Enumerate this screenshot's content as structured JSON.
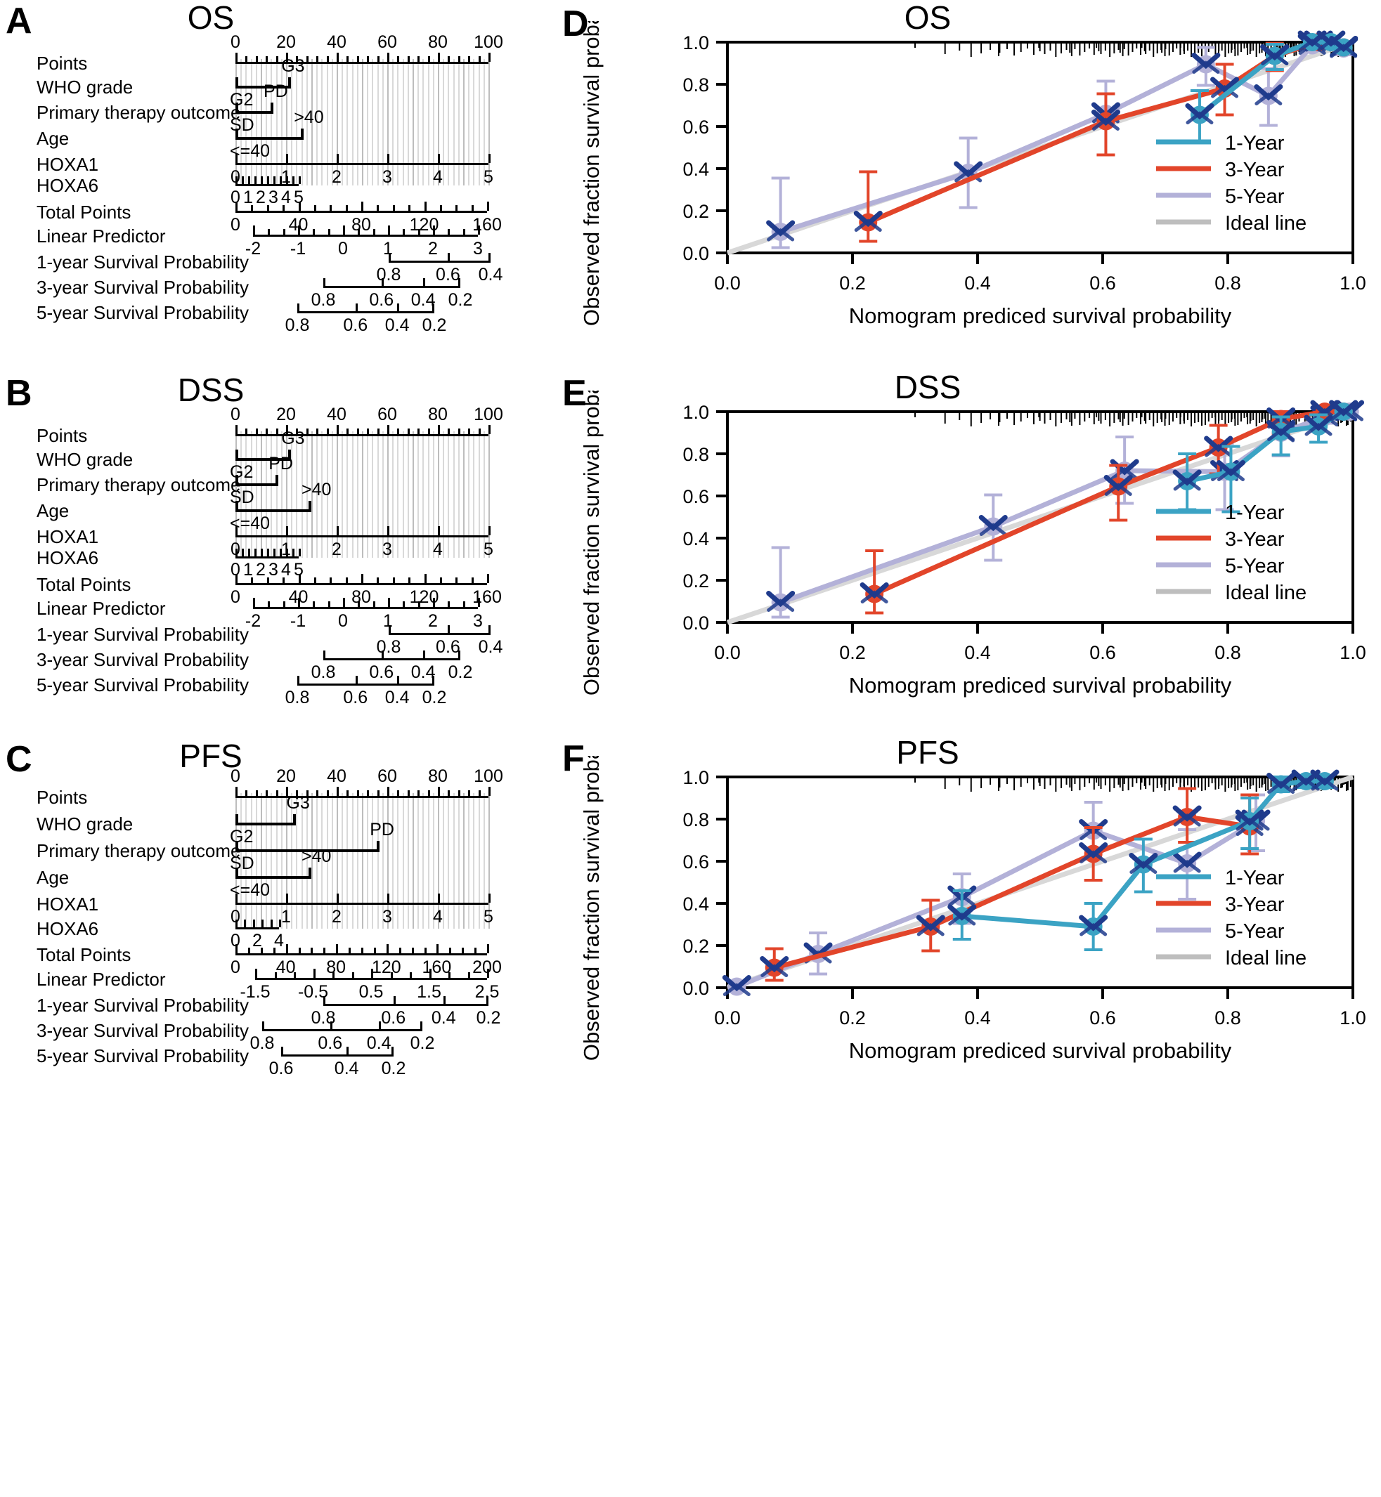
{
  "figure": {
    "panels": [
      "A",
      "B",
      "C",
      "D",
      "E",
      "F"
    ],
    "titles": {
      "A": "OS",
      "B": "DSS",
      "C": "PFS",
      "D": "OS",
      "E": "DSS",
      "F": "PFS"
    }
  },
  "nomogram": {
    "row_labels": [
      "Points",
      "WHO grade",
      "Primary therapy outcome",
      "Age",
      "HOXA1",
      "HOXA6",
      "Total Points",
      "Linear Predictor",
      "1-year Survival Probability",
      "3-year Survival Probability",
      "5-year Survival Probability"
    ],
    "category_labels": {
      "who_high": "G3",
      "who_low": "G2",
      "therapy_high": "PD",
      "therapy_low": "SD",
      "age_high": ">40",
      "age_low": "<=40"
    },
    "A": {
      "points_ticks": [
        "0",
        "20",
        "40",
        "60",
        "80",
        "100"
      ],
      "hoxa1_ticks": [
        "0",
        "1",
        "2",
        "3",
        "4",
        "5"
      ],
      "hoxa6_ticks": [
        "5",
        "4",
        "3",
        "2",
        "1",
        "0"
      ],
      "total_points_ticks": [
        "0",
        "40",
        "80",
        "120",
        "160"
      ],
      "linear_predictor_ticks": [
        "-2",
        "-1",
        "0",
        "1",
        "2",
        "3"
      ],
      "surv1_ticks": [
        "0.8",
        "0.6",
        "0.4"
      ],
      "surv3_ticks": [
        "0.8",
        "0.6",
        "0.4",
        "0.2"
      ],
      "surv5_ticks": [
        "0.8",
        "0.6",
        "0.4",
        "0.2"
      ],
      "who_points": 22,
      "therapy_points": 15,
      "age_points": 27
    },
    "B": {
      "points_ticks": [
        "0",
        "20",
        "40",
        "60",
        "80",
        "100"
      ],
      "hoxa1_ticks": [
        "0",
        "1",
        "2",
        "3",
        "4",
        "5"
      ],
      "hoxa6_ticks": [
        "5",
        "4",
        "3",
        "2",
        "1",
        "0"
      ],
      "total_points_ticks": [
        "0",
        "40",
        "80",
        "120",
        "160"
      ],
      "linear_predictor_ticks": [
        "-2",
        "-1",
        "0",
        "1",
        "2",
        "3"
      ],
      "surv1_ticks": [
        "0.8",
        "0.6",
        "0.4"
      ],
      "surv3_ticks": [
        "0.8",
        "0.6",
        "0.4",
        "0.2"
      ],
      "surv5_ticks": [
        "0.8",
        "0.6",
        "0.4",
        "0.2"
      ],
      "who_points": 22,
      "therapy_points": 17,
      "age_points": 30
    },
    "C": {
      "points_ticks": [
        "0",
        "20",
        "40",
        "60",
        "80",
        "100"
      ],
      "hoxa1_ticks": [
        "0",
        "1",
        "2",
        "3",
        "4",
        "5"
      ],
      "hoxa6_ticks": [
        "4",
        "2",
        "0"
      ],
      "total_points_ticks": [
        "0",
        "40",
        "80",
        "120",
        "160",
        "200"
      ],
      "linear_predictor_ticks": [
        "-1.5",
        "-0.5",
        "0.5",
        "1.5",
        "2.5"
      ],
      "surv1_ticks": [
        "0.8",
        "0.6",
        "0.4",
        "0.2"
      ],
      "surv3_ticks": [
        "0.8",
        "0.6",
        "0.4",
        "0.2"
      ],
      "surv5_ticks": [
        "0.6",
        "0.4",
        "0.2"
      ],
      "who_points": 24,
      "therapy_points": 57,
      "age_points": 30
    }
  },
  "calibration": {
    "xlabel": "Nomogram prediced survival probability",
    "ylabel": "Observed fraction survival probability",
    "xticks": [
      "0.0",
      "0.2",
      "0.4",
      "0.6",
      "0.8",
      "1.0"
    ],
    "yticks": [
      "0.0",
      "0.2",
      "0.4",
      "0.6",
      "0.8",
      "1.0"
    ],
    "legend": [
      {
        "label": "1-Year",
        "color": "#3BA3C4"
      },
      {
        "label": "3-Year",
        "color": "#E2452A"
      },
      {
        "label": "5-Year",
        "color": "#B3B1D8"
      },
      {
        "label": "Ideal line",
        "color": "#BEBEBE"
      }
    ]
  },
  "colors": {
    "year1": "#3BA3C4",
    "year3": "#E2452A",
    "year5": "#B3B1D8",
    "ideal": "#D8D8D8",
    "marker_navy": "#1F3B8C",
    "axis": "#000000",
    "grid": "#D9D9D9"
  },
  "chart_data": [
    {
      "type": "line",
      "panel": "D",
      "title": "OS",
      "xlabel": "Nomogram prediced survival probability",
      "ylabel": "Observed fraction survival probability",
      "xlim": [
        0.0,
        1.0
      ],
      "ylim": [
        0.0,
        1.0
      ],
      "xticks": [
        0.0,
        0.2,
        0.4,
        0.6,
        0.8,
        1.0
      ],
      "yticks": [
        0.0,
        0.2,
        0.4,
        0.6,
        0.8,
        1.0
      ],
      "grid": false,
      "legend_position": "bottom-right",
      "series": [
        {
          "name": "1-Year",
          "color": "#3BA3C4",
          "x": [
            0.755,
            0.875,
            0.935,
            0.965,
            0.985
          ],
          "y": [
            0.655,
            0.935,
            1.0,
            1.0,
            0.975
          ],
          "err_low": [
            0.53,
            0.87,
            1.0,
            1.0,
            0.95
          ],
          "err_high": [
            0.77,
            0.99,
            1.0,
            1.0,
            1.0
          ]
        },
        {
          "name": "3-Year",
          "color": "#E2452A",
          "x": [
            0.225,
            0.605,
            0.795,
            0.875,
            0.945,
            0.985
          ],
          "y": [
            0.145,
            0.625,
            0.78,
            0.935,
            1.0,
            0.975
          ],
          "err_low": [
            0.055,
            0.465,
            0.655,
            0.865,
            1.0,
            0.95
          ],
          "err_high": [
            0.385,
            0.755,
            0.895,
            0.995,
            1.0,
            1.0
          ]
        },
        {
          "name": "5-Year",
          "color": "#B3B1D8",
          "x": [
            0.085,
            0.385,
            0.605,
            0.765,
            0.865,
            0.935,
            0.985
          ],
          "y": [
            0.1,
            0.38,
            0.66,
            0.895,
            0.745,
            0.985,
            0.97
          ],
          "err_low": [
            0.025,
            0.215,
            0.465,
            0.795,
            0.605,
            0.96,
            0.94
          ],
          "err_high": [
            0.355,
            0.545,
            0.815,
            0.975,
            0.875,
            1.0,
            1.0
          ]
        },
        {
          "name": "Ideal line",
          "color": "#D8D8D8",
          "x": [
            0,
            1
          ],
          "y": [
            0,
            1
          ]
        }
      ]
    },
    {
      "type": "line",
      "panel": "E",
      "title": "DSS",
      "xlabel": "Nomogram prediced survival probability",
      "ylabel": "Observed fraction survival probability",
      "xlim": [
        0.0,
        1.0
      ],
      "ylim": [
        0.0,
        1.0
      ],
      "xticks": [
        0.0,
        0.2,
        0.4,
        0.6,
        0.8,
        1.0
      ],
      "yticks": [
        0.0,
        0.2,
        0.4,
        0.6,
        0.8,
        1.0
      ],
      "grid": false,
      "legend_position": "bottom-right",
      "series": [
        {
          "name": "1-Year",
          "color": "#3BA3C4",
          "x": [
            0.735,
            0.805,
            0.885,
            0.945,
            0.985
          ],
          "y": [
            0.67,
            0.715,
            0.905,
            0.93,
            1.0
          ],
          "err_low": [
            0.535,
            0.525,
            0.795,
            0.855,
            1.0
          ],
          "err_high": [
            0.8,
            0.835,
            0.975,
            0.985,
            1.0
          ]
        },
        {
          "name": "3-Year",
          "color": "#E2452A",
          "x": [
            0.235,
            0.625,
            0.785,
            0.885,
            0.955,
            0.985
          ],
          "y": [
            0.135,
            0.645,
            0.83,
            0.965,
            1.0,
            1.0
          ],
          "err_low": [
            0.045,
            0.485,
            0.705,
            0.895,
            1.0,
            1.0
          ],
          "err_high": [
            0.34,
            0.745,
            0.935,
            1.0,
            1.0,
            1.0
          ]
        },
        {
          "name": "5-Year",
          "color": "#B3B1D8",
          "x": [
            0.085,
            0.425,
            0.635,
            0.795,
            0.885,
            0.955,
            0.995
          ],
          "y": [
            0.095,
            0.455,
            0.72,
            0.715,
            0.9,
            0.975,
            1.0
          ],
          "err_low": [
            0.025,
            0.295,
            0.565,
            0.535,
            0.79,
            0.945,
            1.0
          ],
          "err_high": [
            0.355,
            0.605,
            0.88,
            0.85,
            0.965,
            1.0,
            1.0
          ]
        },
        {
          "name": "Ideal line",
          "color": "#D8D8D8",
          "x": [
            0,
            1
          ],
          "y": [
            0,
            1
          ]
        }
      ]
    },
    {
      "type": "line",
      "panel": "F",
      "title": "PFS",
      "xlabel": "Nomogram prediced survival probability",
      "ylabel": "Observed fraction survival probability",
      "xlim": [
        0.0,
        1.0
      ],
      "ylim": [
        0.0,
        1.0
      ],
      "xticks": [
        0.0,
        0.2,
        0.4,
        0.6,
        0.8,
        1.0
      ],
      "yticks": [
        0.0,
        0.2,
        0.4,
        0.6,
        0.8,
        1.0
      ],
      "grid": false,
      "legend_position": "bottom-right",
      "series": [
        {
          "name": "1-Year",
          "color": "#3BA3C4",
          "x": [
            0.375,
            0.585,
            0.665,
            0.835,
            0.885,
            0.925,
            0.955
          ],
          "y": [
            0.34,
            0.29,
            0.585,
            0.79,
            0.965,
            0.98,
            0.98
          ],
          "err_low": [
            0.23,
            0.18,
            0.455,
            0.66,
            0.93,
            0.95,
            0.95
          ],
          "err_high": [
            0.46,
            0.4,
            0.705,
            0.9,
            1.0,
            1.0,
            1.0
          ]
        },
        {
          "name": "3-Year",
          "color": "#E2452A",
          "x": [
            0.075,
            0.325,
            0.585,
            0.735,
            0.835
          ],
          "y": [
            0.095,
            0.29,
            0.635,
            0.81,
            0.765
          ],
          "err_low": [
            0.035,
            0.175,
            0.51,
            0.69,
            0.635
          ],
          "err_high": [
            0.185,
            0.415,
            0.76,
            0.945,
            0.915
          ]
        },
        {
          "name": "5-Year",
          "color": "#B3B1D8",
          "x": [
            0.015,
            0.145,
            0.375,
            0.585,
            0.735,
            0.845
          ],
          "y": [
            0.005,
            0.16,
            0.43,
            0.745,
            0.59,
            0.79
          ],
          "err_low": [
            0.0,
            0.065,
            0.305,
            0.61,
            0.42,
            0.65
          ],
          "err_high": [
            0.01,
            0.26,
            0.54,
            0.88,
            0.75,
            0.915
          ]
        },
        {
          "name": "Ideal line",
          "color": "#D8D8D8",
          "x": [
            0,
            1
          ],
          "y": [
            0,
            1
          ]
        }
      ]
    }
  ]
}
